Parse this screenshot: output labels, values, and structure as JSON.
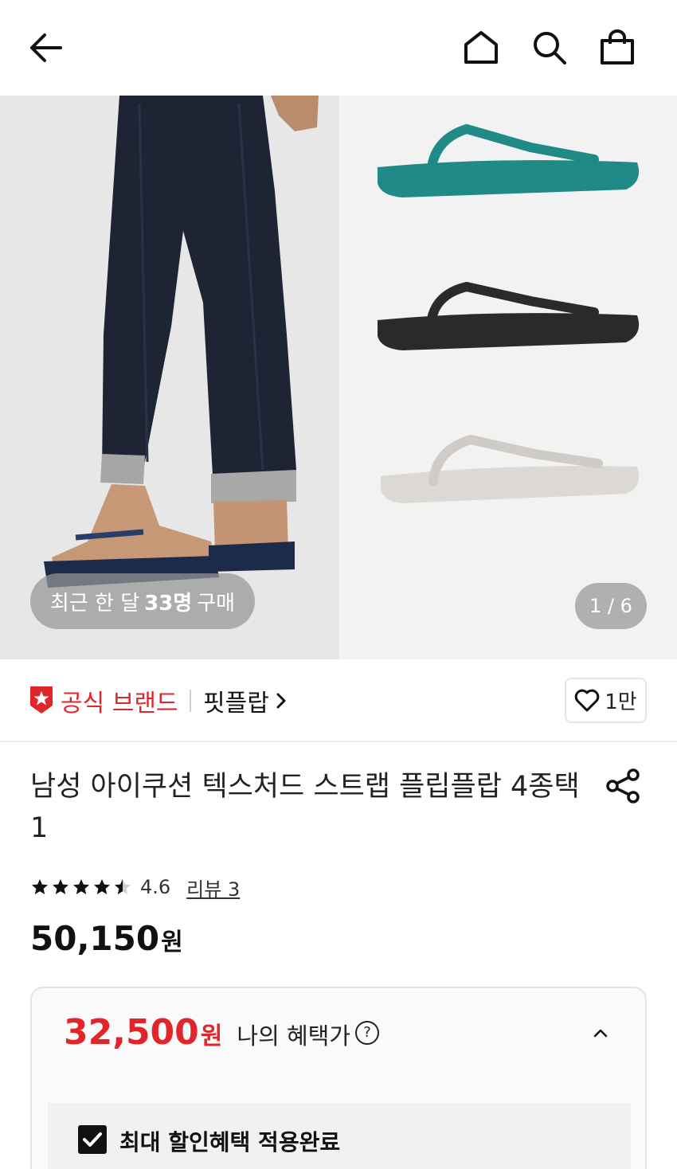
{
  "header": {
    "back_icon": "arrow-left-icon",
    "home_icon": "home-icon",
    "search_icon": "search-icon",
    "bag_icon": "shopping-bag-icon"
  },
  "gallery": {
    "buyers_prefix": "최근 한 달",
    "buyers_count": "33명",
    "buyers_suffix": "구매",
    "page_indicator": "1 / 6",
    "sandal_colors": [
      "#1f8a86",
      "#2a2a2a",
      "#dcd9d4"
    ]
  },
  "brand": {
    "official_label": "공식 브랜드",
    "name": "핏플랍",
    "like_count": "1만",
    "badge_color": "#e0252b"
  },
  "product": {
    "title": "남성 아이쿠션 텍스처드 스트랩 플립플랍 4종택1",
    "rating": 4.6,
    "rating_text": "4.6",
    "reviews_label": "리뷰 3",
    "price": "50,150",
    "currency": "원"
  },
  "benefit": {
    "price": "32,500",
    "currency": "원",
    "label": "나의 혜택가",
    "help": "?",
    "applied_label": "최대 할인혜택 적용완료",
    "applied_checked": true,
    "accent_color": "#e0252b"
  }
}
